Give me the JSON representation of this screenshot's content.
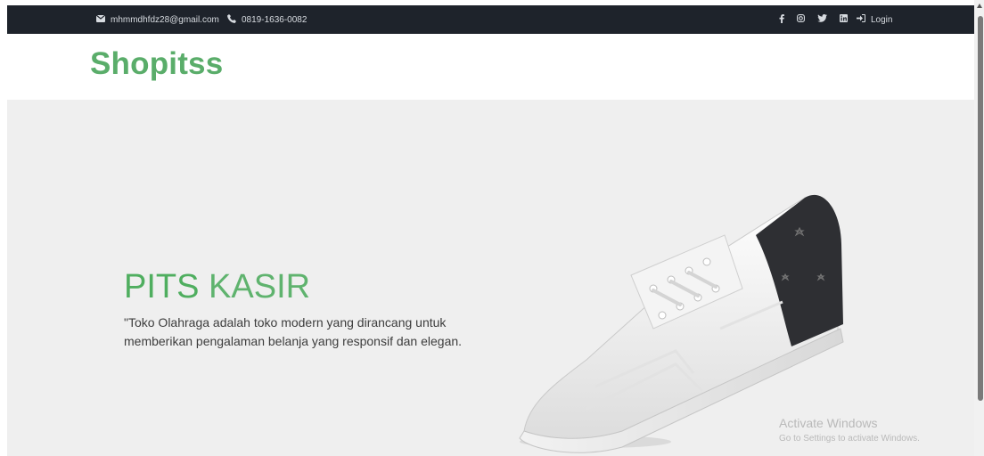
{
  "topbar": {
    "email": "mhmmdhfdz28@gmail.com",
    "phone": "0819-1636-0082",
    "login": "Login",
    "icons": [
      "envelope-icon",
      "phone-icon",
      "facebook-icon",
      "instagram-icon",
      "twitter-icon",
      "linkedin-icon",
      "sign-in-icon"
    ]
  },
  "brand": "Shopitss",
  "hero": {
    "title_strong": "PITS",
    "title_light": " KASIR",
    "text": "\"Toko Olahraga adalah toko modern yang dirancang untuk memberikan pengalaman belanja yang responsif dan elegan."
  },
  "watermark": {
    "title": "Activate Windows",
    "subtitle": "Go to Settings to activate Windows."
  },
  "colors": {
    "brand": "#5aad6a",
    "topbar_bg": "#1e232b",
    "hero_bg": "#efefef"
  }
}
